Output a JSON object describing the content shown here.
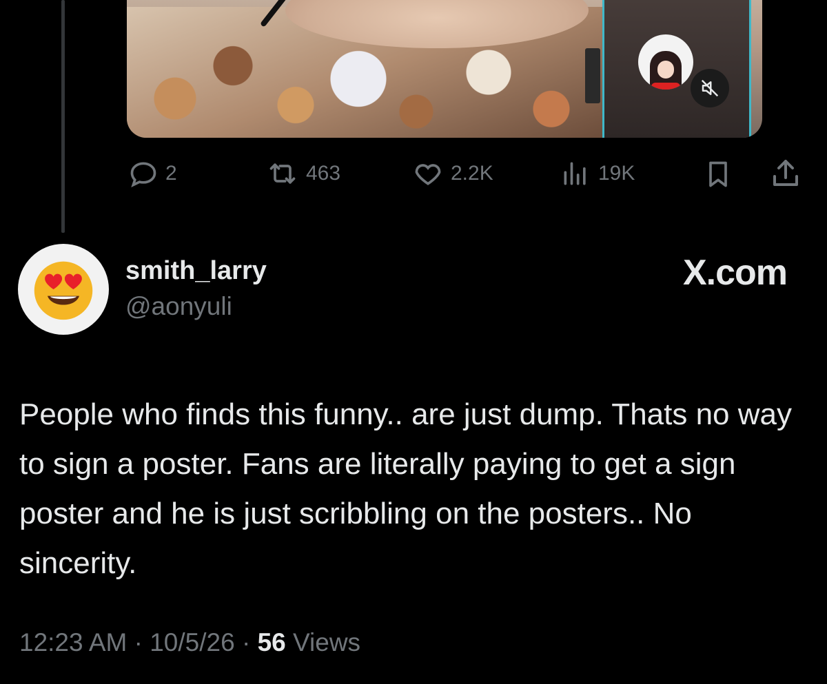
{
  "post": {
    "stats": {
      "replies": "2",
      "reposts": "463",
      "likes": "2.2K",
      "views": "19K"
    }
  },
  "reply": {
    "display_name": "smith_larry",
    "handle": "@aonyuli",
    "brand": "X.com",
    "text": "People who finds this funny.. are just dump. Thats no way to sign a poster. Fans are literally paying to get a sign poster and he is just scribbling on the posters.. No sincerity.",
    "time": "12:23 AM",
    "sep1": " · ",
    "date": "10/5/26",
    "sep2": " · ",
    "views_count": "56",
    "views_label": " Views"
  },
  "icons": {
    "reply": "reply-icon",
    "repost": "repost-icon",
    "like": "heart-icon",
    "views": "views-icon",
    "bookmark": "bookmark-icon",
    "share": "share-icon",
    "mute": "mute-icon",
    "avatar": "heart-eyes-emoji"
  },
  "colors": {
    "background": "#000000",
    "text": "#e7e9ea",
    "muted": "#71767b",
    "thread_line": "#333639",
    "video_border": "#3fb8c9"
  }
}
